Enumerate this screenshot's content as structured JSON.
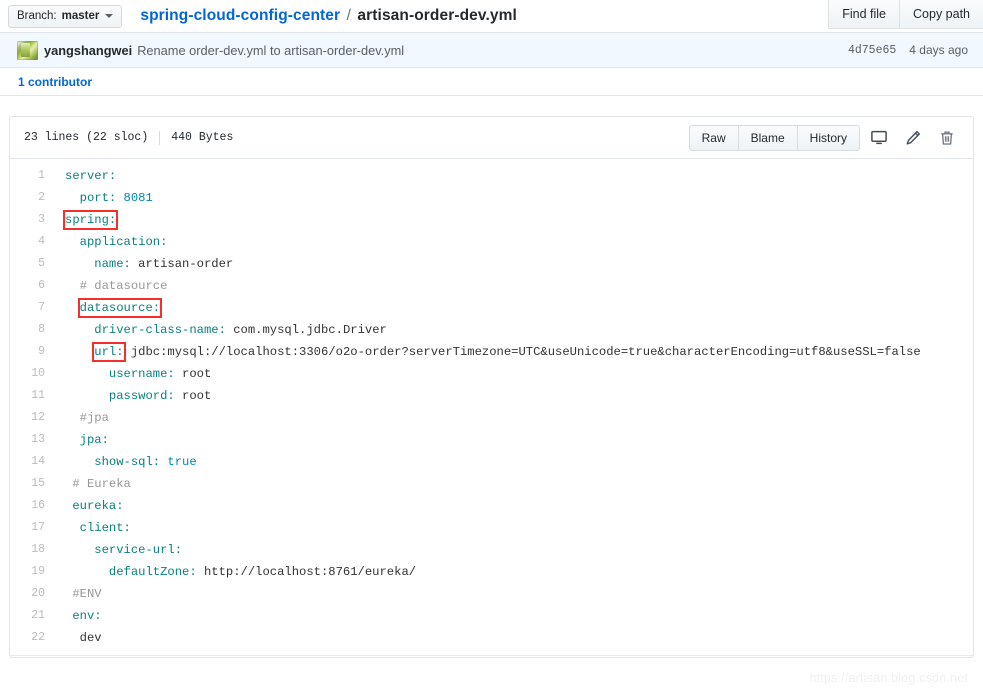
{
  "breadcrumb": {
    "branch_label": "Branch:",
    "branch_value": "master",
    "repo": "spring-cloud-config-center",
    "separator": "/",
    "file_name": "artisan-order-dev.yml"
  },
  "header_actions": [
    {
      "label": "Find file",
      "name": "find-file-button"
    },
    {
      "label": "Copy path",
      "name": "copy-path-button"
    }
  ],
  "commit": {
    "author": "yangshangwei",
    "message": "Rename order-dev.yml to artisan-order-dev.yml",
    "sha": "4d75e65",
    "time": "4 days ago"
  },
  "contributors": {
    "label": "1 contributor"
  },
  "file": {
    "lines_label": "23 lines (22 sloc)",
    "size_label": "440 Bytes",
    "buttons": [
      {
        "label": "Raw",
        "name": "raw-button"
      },
      {
        "label": "Blame",
        "name": "blame-button"
      },
      {
        "label": "History",
        "name": "history-button"
      }
    ],
    "icons": [
      {
        "name": "desktop-icon"
      },
      {
        "name": "pencil-icon"
      },
      {
        "name": "trash-icon"
      }
    ]
  },
  "code": {
    "language": "yaml",
    "highlight_color": "#f3312a",
    "lines": [
      {
        "no": "1",
        "indent": 0,
        "segments": [
          {
            "t": "server:",
            "c": "k"
          }
        ]
      },
      {
        "no": "2",
        "indent": 2,
        "segments": [
          {
            "t": "port: ",
            "c": "k"
          },
          {
            "t": "8081",
            "c": "n"
          }
        ]
      },
      {
        "no": "3",
        "indent": 0,
        "segments": [
          {
            "t": "spring:",
            "c": "k",
            "hl": true
          }
        ]
      },
      {
        "no": "4",
        "indent": 2,
        "segments": [
          {
            "t": "application:",
            "c": "k"
          }
        ]
      },
      {
        "no": "5",
        "indent": 4,
        "segments": [
          {
            "t": "name: ",
            "c": "k"
          },
          {
            "t": "artisan-order",
            "c": "v"
          }
        ]
      },
      {
        "no": "6",
        "indent": 2,
        "segments": [
          {
            "t": "# datasource",
            "c": "cm"
          }
        ]
      },
      {
        "no": "7",
        "indent": 2,
        "segments": [
          {
            "t": "datasource:",
            "c": "k",
            "hl": true
          }
        ]
      },
      {
        "no": "8",
        "indent": 4,
        "segments": [
          {
            "t": "driver-class-name: ",
            "c": "k"
          },
          {
            "t": "com.mysql.jdbc.Driver",
            "c": "v"
          }
        ]
      },
      {
        "no": "9",
        "indent": 4,
        "segments": [
          {
            "t": "url:",
            "c": "k",
            "hl": true
          },
          {
            "t": " jdbc:mysql://localhost:3306/o2o-order?serverTimezone=UTC&useUnicode=true&characterEncoding=utf8&useSSL=false",
            "c": "v"
          }
        ]
      },
      {
        "no": "10",
        "indent": 6,
        "segments": [
          {
            "t": "username: ",
            "c": "k"
          },
          {
            "t": "root",
            "c": "v"
          }
        ]
      },
      {
        "no": "11",
        "indent": 6,
        "segments": [
          {
            "t": "password: ",
            "c": "k"
          },
          {
            "t": "root",
            "c": "v"
          }
        ]
      },
      {
        "no": "12",
        "indent": 2,
        "segments": [
          {
            "t": "#jpa",
            "c": "cm"
          }
        ]
      },
      {
        "no": "13",
        "indent": 2,
        "segments": [
          {
            "t": "jpa:",
            "c": "k"
          }
        ]
      },
      {
        "no": "14",
        "indent": 4,
        "segments": [
          {
            "t": "show-sql: ",
            "c": "k"
          },
          {
            "t": "true",
            "c": "n"
          }
        ]
      },
      {
        "no": "15",
        "indent": 1,
        "segments": [
          {
            "t": "# Eureka",
            "c": "cm"
          }
        ]
      },
      {
        "no": "16",
        "indent": 1,
        "segments": [
          {
            "t": "eureka:",
            "c": "k"
          }
        ]
      },
      {
        "no": "17",
        "indent": 2,
        "segments": [
          {
            "t": "client:",
            "c": "k"
          }
        ]
      },
      {
        "no": "18",
        "indent": 4,
        "segments": [
          {
            "t": "service-url:",
            "c": "k"
          }
        ]
      },
      {
        "no": "19",
        "indent": 6,
        "segments": [
          {
            "t": "defaultZone: ",
            "c": "k"
          },
          {
            "t": "http://localhost:8761/eureka/",
            "c": "v"
          }
        ]
      },
      {
        "no": "20",
        "indent": 1,
        "segments": [
          {
            "t": "#ENV",
            "c": "cm"
          }
        ]
      },
      {
        "no": "21",
        "indent": 1,
        "segments": [
          {
            "t": "env:",
            "c": "k"
          }
        ]
      },
      {
        "no": "22",
        "indent": 2,
        "segments": [
          {
            "t": "dev",
            "c": "v"
          }
        ]
      }
    ]
  },
  "watermark": {
    "text": "https://artisan.blog.csdn.net"
  }
}
